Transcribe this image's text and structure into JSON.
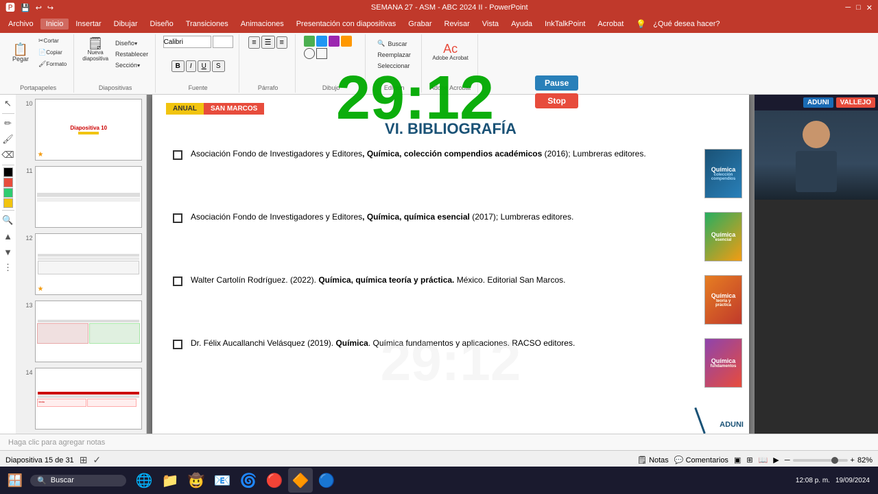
{
  "titlebar": {
    "title": "SEMANA 27 - ASM - ABC 2024 II - PowerPoint",
    "close": "✕"
  },
  "menubar": {
    "items": [
      "Archivo",
      "Inicio",
      "Insertar",
      "Dibujar",
      "Diseño",
      "Transiciones",
      "Animaciones",
      "Presentación con diapositivas",
      "Grabar",
      "Revisar",
      "Vista",
      "Ayuda",
      "InkTalkPoint",
      "Acrobat",
      "¿Qué desea hacer?"
    ]
  },
  "ribbon": {
    "groups": [
      "Portapapeles",
      "Diapositivas",
      "Fuente",
      "Párrafo",
      "Dibujo",
      "Edición",
      "Adobe Acrobat"
    ],
    "nueva_diapositiva": "Nueva\ndiapositiva",
    "diseno_label": "Diseño",
    "restablecer_label": "Restablecer",
    "seccion_label": "Sección",
    "buscar_label": "Buscar",
    "reemplazar_label": "Reemplazar",
    "seleccionar_label": "Seleccionar"
  },
  "timer": {
    "display": "29:12",
    "pause_label": "Pause",
    "stop_label": "Stop"
  },
  "slides": [
    {
      "num": "10",
      "active": false,
      "star": true
    },
    {
      "num": "11",
      "active": false,
      "star": false
    },
    {
      "num": "12",
      "active": false,
      "star": true
    },
    {
      "num": "13",
      "active": false,
      "star": false
    },
    {
      "num": "14",
      "active": false,
      "star": false
    },
    {
      "num": "15",
      "active": true,
      "star": false
    }
  ],
  "slide": {
    "badge_anual": "ANUAL",
    "badge_sanmarcos": "SAN MARCOS",
    "title": "VI. BIBLIOGRAFÍA",
    "watermark": "29:12",
    "entries": [
      {
        "text_html": "Asociación Fondo de Investigadores y Editores, <b>Química, colección compendios académicos</b> (2016); Lumbreras editores.",
        "cover_label": "Química",
        "cover_class": "cover-1"
      },
      {
        "text_html": "Asociación Fondo de Investigadores y Editores, <b>Química, química esencial</b> (2017); Lumbreras editores.",
        "cover_label": "Química esencial",
        "cover_class": "cover-2"
      },
      {
        "text_html": "Walter Cartolín Rodríguez. (2022). <b>Química, química teoría y práctica.</b> México. Editorial San Marcos.",
        "cover_label": "Química teoría",
        "cover_class": "cover-3"
      },
      {
        "text_html": "Dr. Félix Aucallanchi Velásquez (2019). <b>Química</b>. Química  fundamentos y aplicaciones. RACSO editores.",
        "cover_label": "Química fund.",
        "cover_class": "cover-4"
      }
    ],
    "aduni_label": "ADUNI"
  },
  "notes": {
    "placeholder": "Haga clic para agregar notas"
  },
  "statusbar": {
    "slide_info": "Diapositiva 15 de 31",
    "notes_label": "Notas",
    "comments_label": "Comentarios",
    "zoom_percent": "82%",
    "time": "12:08 p. m.",
    "date": "19/09/2024"
  },
  "taskbar": {
    "search_placeholder": "Buscar",
    "icons": [
      "🪟",
      "🌐",
      "📁",
      "🤠",
      "📧",
      "🔍",
      "🌀",
      "🔴"
    ]
  }
}
